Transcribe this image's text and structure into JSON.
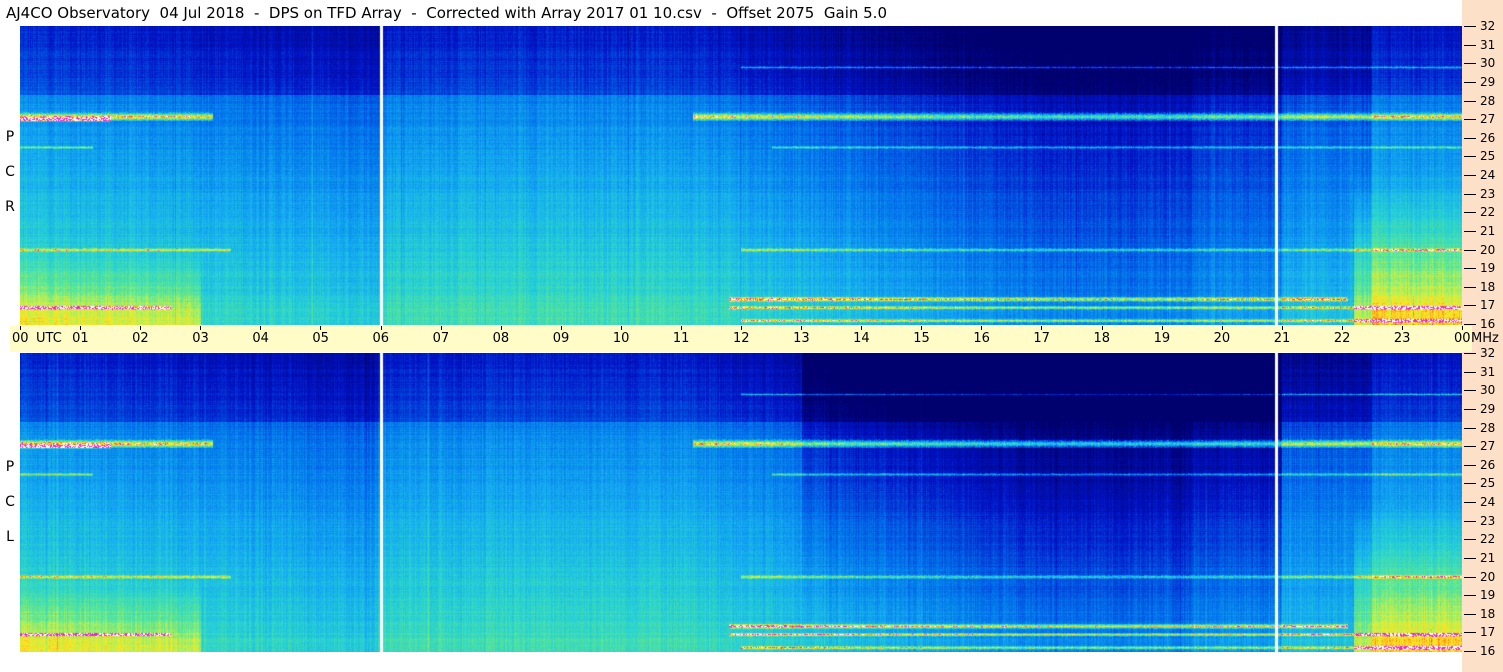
{
  "header": {
    "title": "AJ4CO Observatory  04 Jul 2018  -  DPS on TFD Array  -  Corrected with Array 2017 01 10.csv  -  Offset 2075  Gain 5.0"
  },
  "time_axis": {
    "labels": [
      "00",
      "UTC",
      "01",
      "02",
      "03",
      "04",
      "05",
      "06",
      "07",
      "08",
      "09",
      "10",
      "11",
      "12",
      "13",
      "14",
      "15",
      "16",
      "17",
      "18",
      "19",
      "20",
      "21",
      "22",
      "23",
      "00",
      "MHz"
    ]
  },
  "panels": {
    "rcp": {
      "label_letters": [
        "P",
        "C",
        "R"
      ]
    },
    "lcp": {
      "label_letters": [
        "P",
        "C",
        "L"
      ]
    }
  },
  "freq_axis": {
    "labels": [
      "32",
      "31",
      "30",
      "29",
      "28",
      "27",
      "26",
      "25",
      "24",
      "23",
      "22",
      "21",
      "20",
      "19",
      "18",
      "17",
      "16"
    ]
  },
  "colors": {
    "title_bg": "#ffffff",
    "time_axis_bg": "#fffcc8",
    "freq_strip_bg": "#fde0c8",
    "cursor_line": "#ffffff"
  },
  "chart_data": {
    "type": "heatmap",
    "x_label": "UTC",
    "y_label": "MHz",
    "x_range": [
      0,
      24
    ],
    "y_range": [
      16,
      32
    ],
    "panels": [
      "RCP",
      "LCP"
    ],
    "cursor_markers_utc": [
      6.0,
      20.9
    ],
    "features": [
      {
        "freq_mhz": 27.1,
        "utc_ranges": [
          [
            0,
            3
          ],
          [
            11,
            24
          ]
        ],
        "description_label": ""
      },
      {
        "freq_mhz": 17.3,
        "utc_ranges": [
          [
            11.8,
            24
          ]
        ],
        "description_label": ""
      },
      {
        "freq_mhz": 20.0,
        "utc_ranges": [
          [
            0,
            4
          ],
          [
            12,
            24
          ]
        ],
        "description_label": ""
      }
    ]
  }
}
